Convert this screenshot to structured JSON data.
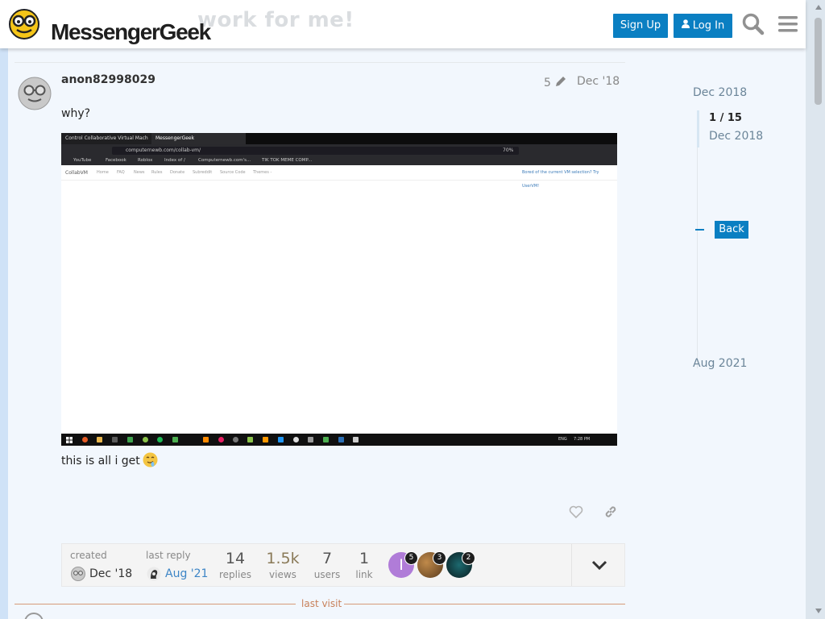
{
  "header": {
    "logo_text": "MessengerGeek",
    "ghost_title": "work for me!",
    "sign_up": "Sign Up",
    "log_in": "Log In",
    "icons": [
      "search-icon",
      "hamburger-menu-icon"
    ]
  },
  "post": {
    "username": "anon82998029",
    "edits": "5",
    "date": "Dec '18",
    "text_before": "why?",
    "text_after": "this is all i get",
    "emoji": "drooling-face-emoji",
    "actions": [
      "heart-icon",
      "link-icon"
    ]
  },
  "screenshot": {
    "tab1": "Control Collaborative Virtual Mach",
    "tab2": "MessengerGeek",
    "url": "computernewb.com/collab-vm/",
    "zoom": "70%",
    "bookmarks": [
      "YouTube",
      "Facebook",
      "Roblox",
      "Index of /",
      "Computernewb.com's...",
      "TIK TOK MEME COMP..."
    ],
    "site_nav": [
      "CollabVM",
      "Home",
      "FAQ",
      "News",
      "Rules",
      "Donate",
      "Subreddit",
      "Source Code",
      "Themes -"
    ],
    "site_notice": "Bored of the current VM selection? Try UserVM!",
    "taskbar_lang": "ENG",
    "taskbar_time": "7:28 PM"
  },
  "topic_map": {
    "created_label": "created",
    "created_date": "Dec '18",
    "last_reply_label": "last reply",
    "last_reply_date": "Aug '21",
    "replies": "14",
    "replies_label": "replies",
    "views": "1.5k",
    "views_label": "views",
    "users": "7",
    "users_label": "users",
    "links": "1",
    "links_label": "link",
    "participants": [
      {
        "initial": "I",
        "count": "5"
      },
      {
        "initial": "",
        "count": "3"
      },
      {
        "initial": "",
        "count": "2"
      }
    ]
  },
  "last_visit": "last visit",
  "timeline": {
    "top_date": "Dec 2018",
    "position": "1 / 15",
    "current_date": "Dec 2018",
    "back": "Back",
    "bottom_date": "Aug 2021"
  }
}
